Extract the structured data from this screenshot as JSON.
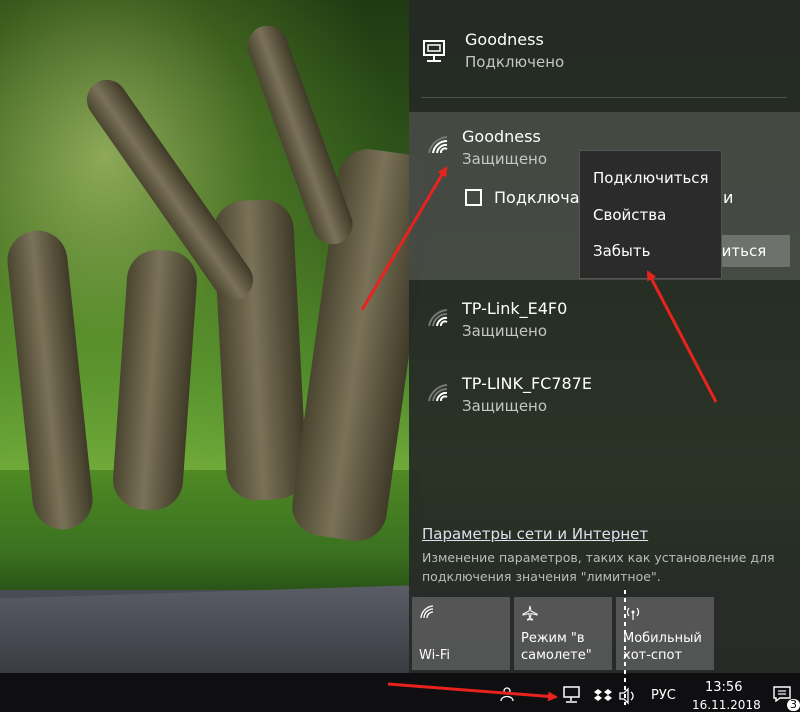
{
  "current_connection": {
    "name": "Goodness",
    "status": "Подключено"
  },
  "networks": [
    {
      "name": "Goodness",
      "status": "Защищено"
    },
    {
      "name": "TP-Link_E4F0",
      "status": "Защищено"
    },
    {
      "name": "TP-LINK_FC787E",
      "status": "Защищено"
    }
  ],
  "selected_network": {
    "auto_connect_label": "Подключа",
    "auto_connect_tail": "и",
    "connect_button": "читься"
  },
  "context_menu": {
    "items": [
      "Подключиться",
      "Свойства",
      "Забыть"
    ]
  },
  "settings": {
    "link": "Параметры сети и Интернет",
    "description": "Изменение параметров, таких как установление для подключения значения \"лимитное\"."
  },
  "quick_actions": [
    {
      "label": "Wi-Fi",
      "icon": "wifi-icon"
    },
    {
      "label": "Режим \"в самолете\"",
      "icon": "airplane-icon"
    },
    {
      "label": "Мобильный хот-спот",
      "icon": "hotspot-icon"
    }
  ],
  "taskbar": {
    "language": "РУС",
    "time": "13:56",
    "date": "16.11.2018",
    "notifications": "3"
  },
  "colors": {
    "arrow": "#e8221c",
    "panel": "#262a26",
    "taskbar": "#0f0f12"
  }
}
